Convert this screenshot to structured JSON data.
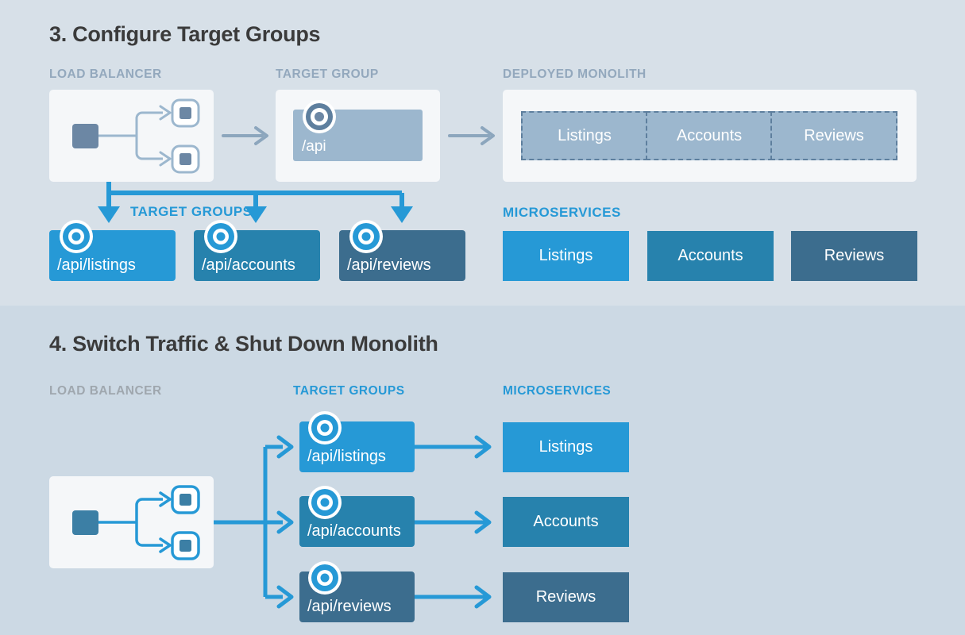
{
  "colors": {
    "bg_section_3": "#d7e0e8",
    "bg_section_4": "#ccd9e4",
    "card_bg": "#f5f7f9",
    "muted_blue": "#9cb7ce",
    "muted_blue_border": "#5e7f9e",
    "label_gray": "#93a8bd",
    "label_gray_dim": "#9fa7ae",
    "accent_blue": "#2699d6",
    "blue_light": "#2699d6",
    "blue_mid": "#2782ad",
    "blue_dark": "#3c6d8e",
    "arrow_gray": "#8ca6bd",
    "title_dark": "#3b3b3b"
  },
  "section_3": {
    "title": "3. Configure Target Groups",
    "labels": {
      "load_balancer": "LOAD BALANCER",
      "target_group": "TARGET GROUP",
      "deployed_monolith": "DEPLOYED MONOLITH",
      "target_groups": "TARGET GROUPS",
      "microservices": "MICROSERVICES"
    },
    "target_group_path": "/api",
    "monolith_segments": [
      "Listings",
      "Accounts",
      "Reviews"
    ],
    "target_groups": [
      {
        "path": "/api/listings",
        "color": "#2699d6"
      },
      {
        "path": "/api/accounts",
        "color": "#2782ad"
      },
      {
        "path": "/api/reviews",
        "color": "#3c6d8e"
      }
    ],
    "microservices": [
      {
        "name": "Listings",
        "color": "#2699d6"
      },
      {
        "name": "Accounts",
        "color": "#2782ad"
      },
      {
        "name": "Reviews",
        "color": "#3c6d8e"
      }
    ]
  },
  "section_4": {
    "title": "4. Switch Traffic & Shut Down Monolith",
    "labels": {
      "load_balancer": "LOAD BALANCER",
      "target_groups": "TARGET GROUPS",
      "microservices": "MICROSERVICES"
    },
    "rows": [
      {
        "path": "/api/listings",
        "service": "Listings",
        "color": "#2699d6"
      },
      {
        "path": "/api/accounts",
        "service": "Accounts",
        "color": "#2782ad"
      },
      {
        "path": "/api/reviews",
        "service": "Reviews",
        "color": "#3c6d8e"
      }
    ]
  }
}
